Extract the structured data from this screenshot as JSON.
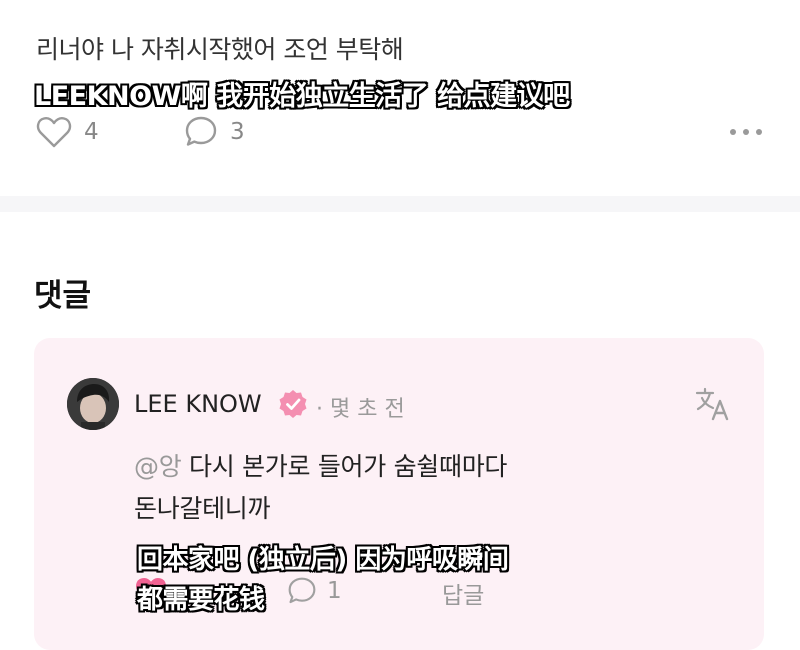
{
  "post": {
    "text": "리너야 나 자취시작했어 조언 부탁해",
    "likes": "4",
    "comments": "3"
  },
  "subtitles": {
    "top": "LEEKNOW啊 我开始独立生活了 给点建议吧",
    "bottom_line1": "回本家吧 (独立后) 因为呼吸瞬间",
    "bottom_line2": "都需要花钱"
  },
  "comments_section": {
    "title": "댓글"
  },
  "comment": {
    "author": "LEE KNOW",
    "time": "· 몇 초 전",
    "mention": "@앙",
    "text_line1": " 다시 본가로 들어가 숨쉴때마다",
    "text_line2": "돈나갈테니까",
    "comment_count": "1",
    "reply_label": "답글"
  },
  "colors": {
    "card_bg": "#fdf1f6",
    "badge": "#f48fb1",
    "heart_filled": "#f06292"
  },
  "icons": [
    "heart-icon",
    "speech-bubble-icon",
    "more-dots-icon",
    "verified-badge-icon",
    "translate-icon"
  ]
}
